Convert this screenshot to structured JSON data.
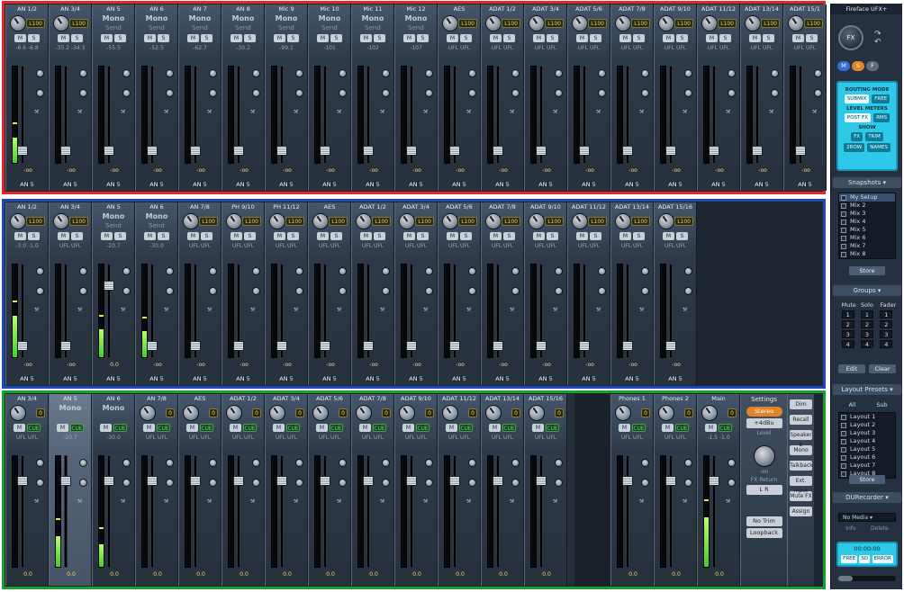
{
  "app": {
    "title": "Fireface UFX+"
  },
  "colors": {
    "inputs_border": "#e8242b",
    "playback_border": "#1e47b8",
    "outputs_border": "#18a02c",
    "cyan_panel": "#2ec8e8"
  },
  "inputs": {
    "channels": [
      {
        "name": "AN 1/2",
        "type": "stereo",
        "pan": "L100",
        "mute": "M",
        "solo": "S",
        "level": "-6.6  -6.8",
        "db": "-oo",
        "footer": "AN 5",
        "meter": 0.26
      },
      {
        "name": "AN 3/4",
        "type": "stereo",
        "pan": "L100",
        "mute": "M",
        "solo": "S",
        "level": "-35.2 -34.3",
        "db": "-oo",
        "footer": "AN 5",
        "meter": 0
      },
      {
        "name": "AN 5",
        "type": "mono",
        "mono": "Mono",
        "send": "Send",
        "mute": "M",
        "solo": "S",
        "level": "-55.5",
        "db": "-oo",
        "footer": "AN 5",
        "meter": 0
      },
      {
        "name": "AN 6",
        "type": "mono",
        "mono": "Mono",
        "send": "Send",
        "mute": "M",
        "solo": "S",
        "level": "-52.5",
        "db": "-oo",
        "footer": "AN 5",
        "meter": 0
      },
      {
        "name": "AN 7",
        "type": "mono",
        "mono": "Mono",
        "send": "Send",
        "mute": "M",
        "solo": "S",
        "level": "-62.7",
        "db": "-oo",
        "footer": "AN 5",
        "meter": 0
      },
      {
        "name": "AN 8",
        "type": "mono",
        "mono": "Mono",
        "send": "Send",
        "mute": "M",
        "solo": "S",
        "level": "-30.2",
        "db": "-oo",
        "footer": "AN 5",
        "meter": 0
      },
      {
        "name": "Mic 9",
        "type": "mono",
        "mono": "Mono",
        "send": "Send",
        "mute": "M",
        "solo": "S",
        "level": "-99.1",
        "db": "-oo",
        "footer": "AN 5",
        "meter": 0
      },
      {
        "name": "Mic 10",
        "type": "mono",
        "mono": "Mono",
        "send": "Send",
        "mute": "M",
        "solo": "S",
        "level": "-101",
        "db": "-oo",
        "footer": "AN 5",
        "meter": 0
      },
      {
        "name": "Mic 11",
        "type": "mono",
        "mono": "Mono",
        "send": "Send",
        "mute": "M",
        "solo": "S",
        "level": "-102",
        "db": "-oo",
        "footer": "AN 5",
        "meter": 0
      },
      {
        "name": "Mic 12",
        "type": "mono",
        "mono": "Mono",
        "send": "Send",
        "mute": "M",
        "solo": "S",
        "level": "-107",
        "db": "-oo",
        "footer": "AN 5",
        "meter": 0
      },
      {
        "name": "AES",
        "type": "stereo",
        "pan": "L100",
        "mute": "M",
        "solo": "S",
        "level": "UFL  UFL",
        "db": "-oo",
        "footer": "AN 5",
        "meter": 0
      },
      {
        "name": "ADAT 1/2",
        "type": "stereo",
        "pan": "L100",
        "mute": "M",
        "solo": "S",
        "level": "UFL  UFL",
        "db": "-oo",
        "footer": "AN 5",
        "meter": 0
      },
      {
        "name": "ADAT 3/4",
        "type": "stereo",
        "pan": "L100",
        "mute": "M",
        "solo": "S",
        "level": "UFL  UFL",
        "db": "-oo",
        "footer": "AN 5",
        "meter": 0
      },
      {
        "name": "ADAT 5/6",
        "type": "stereo",
        "pan": "L100",
        "mute": "M",
        "solo": "S",
        "level": "UFL  UFL",
        "db": "-oo",
        "footer": "AN 5",
        "meter": 0
      },
      {
        "name": "ADAT 7/8",
        "type": "stereo",
        "pan": "L100",
        "mute": "M",
        "solo": "S",
        "level": "UFL  UFL",
        "db": "-oo",
        "footer": "AN 5",
        "meter": 0
      },
      {
        "name": "ADAT 9/10",
        "type": "stereo",
        "pan": "L100",
        "mute": "M",
        "solo": "S",
        "level": "UFL  UFL",
        "db": "-oo",
        "footer": "AN 5",
        "meter": 0
      },
      {
        "name": "ADAT 11/12",
        "type": "stereo",
        "pan": "L100",
        "mute": "M",
        "solo": "S",
        "level": "UFL  UFL",
        "db": "-oo",
        "footer": "AN 5",
        "meter": 0
      },
      {
        "name": "ADAT 13/14",
        "type": "stereo",
        "pan": "L100",
        "mute": "M",
        "solo": "S",
        "level": "UFL  UFL",
        "db": "-oo",
        "footer": "AN 5",
        "meter": 0
      },
      {
        "name": "ADAT 15/1",
        "type": "stereo",
        "pan": "L100",
        "mute": "M",
        "solo": "S",
        "level": "UFL  UFL",
        "db": "-oo",
        "footer": "AN 5",
        "meter": 0
      }
    ]
  },
  "playback": {
    "channels": [
      {
        "name": "AN 1/2",
        "type": "stereo",
        "pan": "L100",
        "mute": "M",
        "solo": "S",
        "level": "-3.0  -1.0",
        "db": "-oo",
        "footer": "AN 5",
        "meter": 0.45
      },
      {
        "name": "AN 3/4",
        "type": "stereo",
        "pan": "L100",
        "mute": "M",
        "solo": "S",
        "level": "UFL  UFL",
        "db": "-oo",
        "footer": "AN 5",
        "meter": 0
      },
      {
        "name": "AN 5",
        "type": "mono",
        "mono": "Mono",
        "send": "Send",
        "mute": "M",
        "solo": "S",
        "level": "-20.7",
        "db": "0.0",
        "footer": "AN 5",
        "meter": 0.3
      },
      {
        "name": "AN 6",
        "type": "mono",
        "mono": "Mono",
        "send": "Send",
        "mute": "M",
        "solo": "S",
        "level": "-30.0",
        "db": "-oo",
        "footer": "AN 5",
        "meter": 0.28
      },
      {
        "name": "AN 7/8",
        "type": "stereo",
        "pan": "L100",
        "mute": "M",
        "solo": "S",
        "level": "UFL  UFL",
        "db": "-oo",
        "footer": "AN 5",
        "meter": 0
      },
      {
        "name": "PH 9/10",
        "type": "stereo",
        "pan": "L100",
        "mute": "M",
        "solo": "S",
        "level": "UFL  UFL",
        "db": "-oo",
        "footer": "AN 5",
        "meter": 0
      },
      {
        "name": "PH 11/12",
        "type": "stereo",
        "pan": "L100",
        "mute": "M",
        "solo": "S",
        "level": "UFL  UFL",
        "db": "-oo",
        "footer": "AN 5",
        "meter": 0
      },
      {
        "name": "AES",
        "type": "stereo",
        "pan": "L100",
        "mute": "M",
        "solo": "S",
        "level": "UFL  UFL",
        "db": "-oo",
        "footer": "AN 5",
        "meter": 0
      },
      {
        "name": "ADAT 1/2",
        "type": "stereo",
        "pan": "L100",
        "mute": "M",
        "solo": "S",
        "level": "UFL  UFL",
        "db": "-oo",
        "footer": "AN 5",
        "meter": 0
      },
      {
        "name": "ADAT 3/4",
        "type": "stereo",
        "pan": "L100",
        "mute": "M",
        "solo": "S",
        "level": "UFL  UFL",
        "db": "-oo",
        "footer": "AN 5",
        "meter": 0
      },
      {
        "name": "ADAT 5/6",
        "type": "stereo",
        "pan": "L100",
        "mute": "M",
        "solo": "S",
        "level": "UFL  UFL",
        "db": "-oo",
        "footer": "AN 5",
        "meter": 0
      },
      {
        "name": "ADAT 7/8",
        "type": "stereo",
        "pan": "L100",
        "mute": "M",
        "solo": "S",
        "level": "UFL  UFL",
        "db": "-oo",
        "footer": "AN 5",
        "meter": 0
      },
      {
        "name": "ADAT 9/10",
        "type": "stereo",
        "pan": "L100",
        "mute": "M",
        "solo": "S",
        "level": "UFL  UFL",
        "db": "-oo",
        "footer": "AN 5",
        "meter": 0
      },
      {
        "name": "ADAT 11/12",
        "type": "stereo",
        "pan": "L100",
        "mute": "M",
        "solo": "S",
        "level": "UFL  UFL",
        "db": "-oo",
        "footer": "AN 5",
        "meter": 0
      },
      {
        "name": "ADAT 13/14",
        "type": "stereo",
        "pan": "L100",
        "mute": "M",
        "solo": "S",
        "level": "UFL  UFL",
        "db": "-oo",
        "footer": "AN 5",
        "meter": 0
      },
      {
        "name": "ADAT 15/16",
        "type": "stereo",
        "pan": "L100",
        "mute": "M",
        "solo": "S",
        "level": "UFL  UFL",
        "db": "-oo",
        "footer": "AN 5",
        "meter": 0
      }
    ]
  },
  "outputs": {
    "channels": [
      {
        "name": "AN 3/4",
        "type": "out",
        "pan": "0",
        "mute": "M",
        "cue": "CUE",
        "level": "UFL  UFL",
        "db": "0.0",
        "meter": 0
      },
      {
        "name": "AN 5",
        "type": "outmono",
        "mono": "Mono",
        "mute": "M",
        "cue": "CUE",
        "level": "-20.7",
        "db": "0.0",
        "meter": 0.28,
        "selected": true
      },
      {
        "name": "AN 6",
        "type": "outmono",
        "mono": "Mono",
        "mute": "M",
        "cue": "CUE",
        "level": "-30.0",
        "db": "0.0",
        "meter": 0.2
      },
      {
        "name": "AN 7/8",
        "type": "out",
        "pan": "0",
        "mute": "M",
        "cue": "CUE",
        "level": "UFL  UFL",
        "db": "0.0",
        "meter": 0
      },
      {
        "name": "AES",
        "type": "out",
        "pan": "0",
        "mute": "M",
        "cue": "CUE",
        "level": "UFL  UFL",
        "db": "0.0",
        "meter": 0
      },
      {
        "name": "ADAT 1/2",
        "type": "out",
        "pan": "0",
        "mute": "M",
        "cue": "CUE",
        "level": "UFL  UFL",
        "db": "0.0",
        "meter": 0
      },
      {
        "name": "ADAT 3/4",
        "type": "out",
        "pan": "0",
        "mute": "M",
        "cue": "CUE",
        "level": "UFL  UFL",
        "db": "0.0",
        "meter": 0
      },
      {
        "name": "ADAT 5/6",
        "type": "out",
        "pan": "0",
        "mute": "M",
        "cue": "CUE",
        "level": "UFL  UFL",
        "db": "0.0",
        "meter": 0
      },
      {
        "name": "ADAT 7/8",
        "type": "out",
        "pan": "0",
        "mute": "M",
        "cue": "CUE",
        "level": "UFL  UFL",
        "db": "0.0",
        "meter": 0
      },
      {
        "name": "ADAT 9/10",
        "type": "out",
        "pan": "0",
        "mute": "M",
        "cue": "CUE",
        "level": "UFL  UFL",
        "db": "0.0",
        "meter": 0
      },
      {
        "name": "ADAT 11/12",
        "type": "out",
        "pan": "0",
        "mute": "M",
        "cue": "CUE",
        "level": "UFL  UFL",
        "db": "0.0",
        "meter": 0
      },
      {
        "name": "ADAT 13/14",
        "type": "out",
        "pan": "0",
        "mute": "M",
        "cue": "CUE",
        "level": "UFL  UFL",
        "db": "0.0",
        "meter": 0
      },
      {
        "name": "ADAT 15/16",
        "type": "out",
        "pan": "0",
        "mute": "M",
        "cue": "CUE",
        "level": "UFL  UFL",
        "db": "0.0",
        "meter": 0
      }
    ],
    "monitor": [
      {
        "name": "Phones 1",
        "type": "out",
        "pan": "0",
        "mute": "M",
        "cue": "CUE",
        "level": "UFL  UFL",
        "db": "0.0",
        "meter": 0
      },
      {
        "name": "Phones 2",
        "type": "out",
        "pan": "0",
        "mute": "M",
        "cue": "CUE",
        "level": "UFL  UFL",
        "db": "0.0",
        "meter": 0
      },
      {
        "name": "Main",
        "type": "out",
        "pan": "0",
        "mute": "M",
        "cue": "CUE",
        "level": "-1.5  -1.0",
        "db": "0.0",
        "meter": 0.45
      }
    ],
    "settings": {
      "title": "Settings",
      "stereo": "Stereo",
      "level_select": "+4dBu",
      "level_label": "Level",
      "fx_return_value": "-oo",
      "fx_return_label": "FX Return",
      "stereo_toggle": "L R",
      "no_trim": "No Trim",
      "loopback": "Loopback"
    },
    "side_buttons": [
      "Dim",
      "Recall",
      "Speaker B",
      "Mono",
      "Talkback",
      "Ext. Input",
      "Mute FX",
      "Assign"
    ]
  },
  "panel": {
    "fx_label": "FX",
    "mode_buttons": [
      "M",
      "S",
      "F"
    ],
    "routing_mode_label": "ROUTING MODE",
    "routing_mode_options": [
      "SUBMIX",
      "FREE"
    ],
    "level_meters_label": "LEVEL METERS",
    "level_meters_options": [
      "POST FX",
      "RMS"
    ],
    "show_label": "SHOW",
    "show_options": [
      "FX",
      "TRIM",
      "2ROW",
      "NAMES"
    ],
    "snapshots": {
      "title": "Snapshots",
      "items": [
        "My Setup",
        "Mix 2",
        "Mix 3",
        "Mix 4",
        "Mix 5",
        "Mix 6",
        "Mix 7",
        "Mix 8"
      ],
      "store": "Store"
    },
    "groups": {
      "title": "Groups",
      "headers": [
        "Mute",
        "Solo",
        "Fader"
      ],
      "rows": [
        "1",
        "2",
        "3",
        "4"
      ],
      "edit": "Edit",
      "clear": "Clear"
    },
    "layout_presets": {
      "title": "Layout Presets",
      "tabs": [
        "All",
        "Sub"
      ],
      "items": [
        "Layout 1",
        "Layout 2",
        "Layout 3",
        "Layout 4",
        "Layout 5",
        "Layout 6",
        "Layout 7",
        "Layout 8"
      ],
      "store": "Store"
    },
    "durec": {
      "title": "DURecorder",
      "select": "No Media",
      "info_items": [
        "Info",
        "Delete"
      ],
      "time": "00:00:00",
      "transport": [
        "FREE",
        "SD",
        "ERROR"
      ]
    }
  }
}
